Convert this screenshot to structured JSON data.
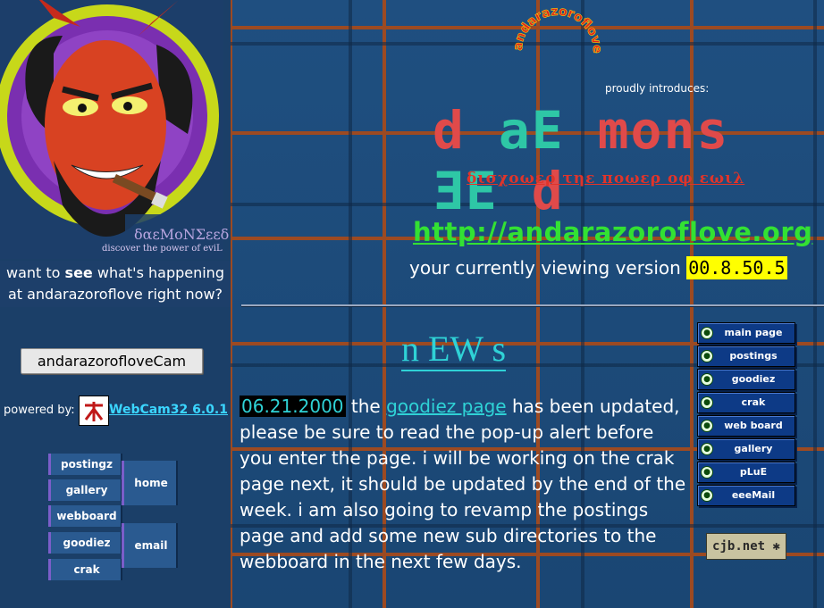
{
  "header": {
    "circle_text": "andarazoroflove",
    "proudly": "proudly introduces:",
    "title_parts": [
      "d ",
      "aE",
      " mons ",
      "ƎE",
      " d"
    ],
    "greek_tagline": "δισχοωερ τηε ποωερ οφ εωιλ",
    "url": "http://andarazoroflove.org",
    "version_prefix": "your currently viewing version",
    "version_number": "00.8.50.5"
  },
  "logo": {
    "name": "δαεMoNΣεεδ",
    "tagline": "discover the power of eviL"
  },
  "sidebar": {
    "want_see_1": "want to ",
    "want_see_bold": "see",
    "want_see_2": " what's happening at andarazoroflove right now?",
    "cam_button": "andarazorofloveCam",
    "powered_by": "powered by:",
    "webcam_link": "WebCam32 6.0.1",
    "nav": [
      "postingz",
      "gallery",
      "webboard",
      "goodiez",
      "crak",
      "home",
      "email"
    ]
  },
  "news": {
    "heading": "n EW s",
    "date": "06.21.2000",
    "text_1": " the ",
    "link": "goodiez page",
    "text_2": " has been updated, please be sure to read the pop-up alert before you enter the page. i will be working on the crak page next, it should be updated by the end of the week. i am also going to revamp the postings page and add some new sub directories to the webboard in the next few days."
  },
  "rightnav": {
    "items": [
      "main page",
      "postings",
      "goodiez",
      "crak",
      "web board",
      "gallery",
      "pLuE",
      "eeeMail"
    ],
    "cjb": "cjb.net"
  },
  "colors": {
    "background": "#1d4a78",
    "grid": "#9c4a22",
    "accent": "#2fd2d6",
    "url": "#33e133",
    "version_bg": "#ffff00"
  }
}
